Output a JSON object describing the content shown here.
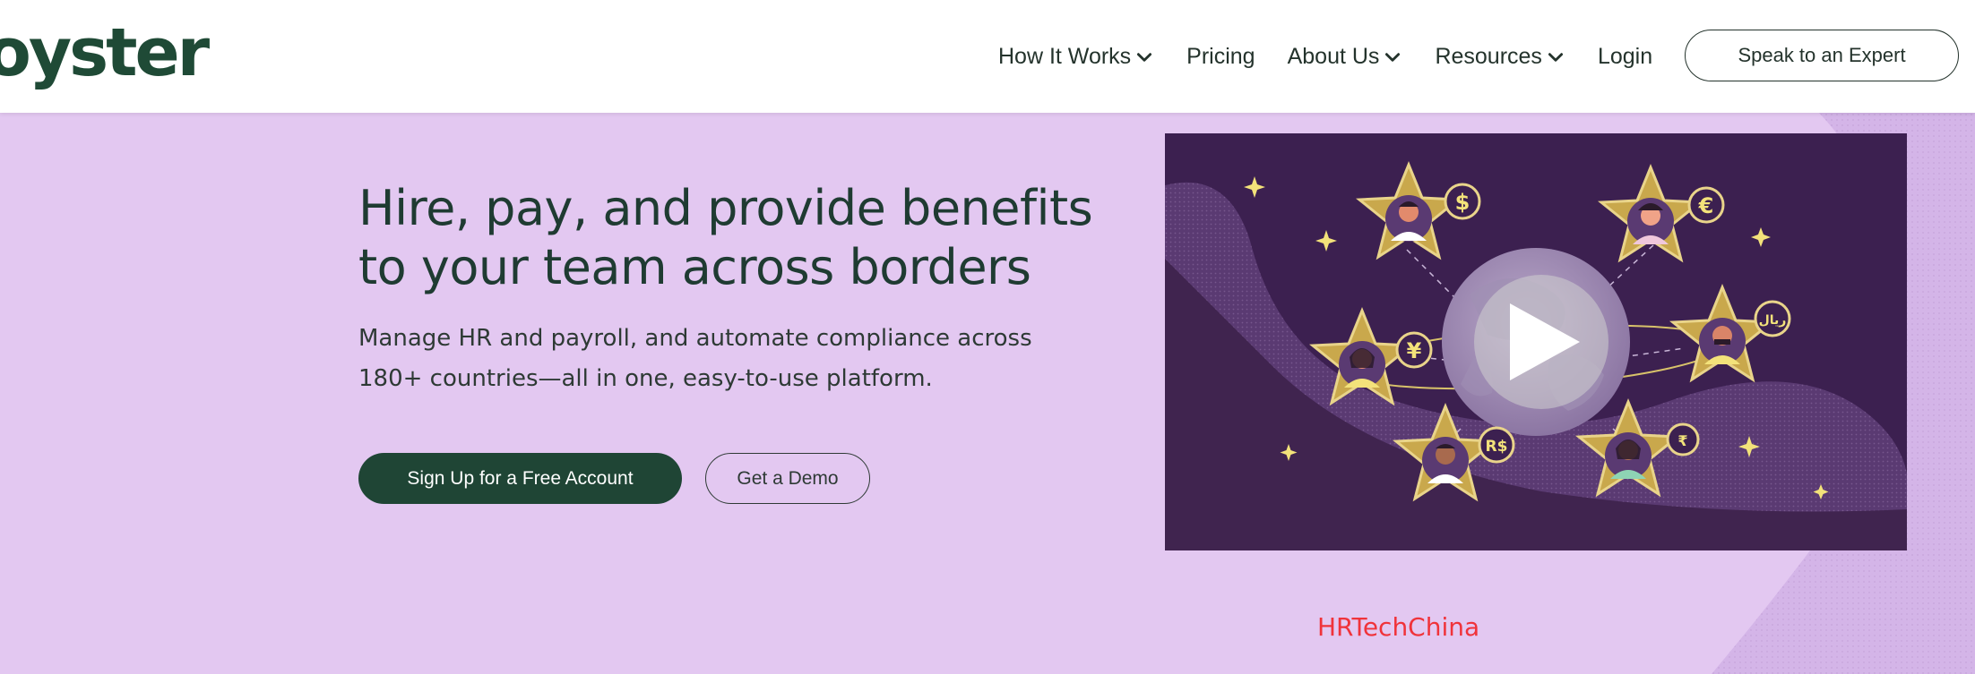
{
  "brand": {
    "logo_text": "oyster",
    "colors": {
      "primary_green": "#1f4535",
      "hero_background": "#e3c8f1",
      "video_background": "#3c2050",
      "watermark_red": "#f0333a"
    }
  },
  "nav": {
    "items": [
      {
        "label": "How It Works",
        "has_dropdown": true
      },
      {
        "label": "Pricing",
        "has_dropdown": false
      },
      {
        "label": "About Us",
        "has_dropdown": true
      },
      {
        "label": "Resources",
        "has_dropdown": true
      },
      {
        "label": "Login",
        "has_dropdown": false
      }
    ],
    "cta_label": "Speak to an Expert"
  },
  "hero": {
    "headline_line1": "Hire, pay, and provide benefits",
    "headline_line2": "to your team across borders",
    "subtext_line1": "Manage HR and payroll, and automate compliance across",
    "subtext_line2": "180+ countries—all in one, easy-to-use platform.",
    "primary_cta": "Sign Up for a Free Account",
    "secondary_cta": "Get a Demo"
  },
  "video": {
    "play_icon": "play-icon",
    "currency_symbols": [
      "$",
      "€",
      "¥",
      "ريال",
      "R$",
      "₹"
    ]
  },
  "watermark": "HRTechChina"
}
